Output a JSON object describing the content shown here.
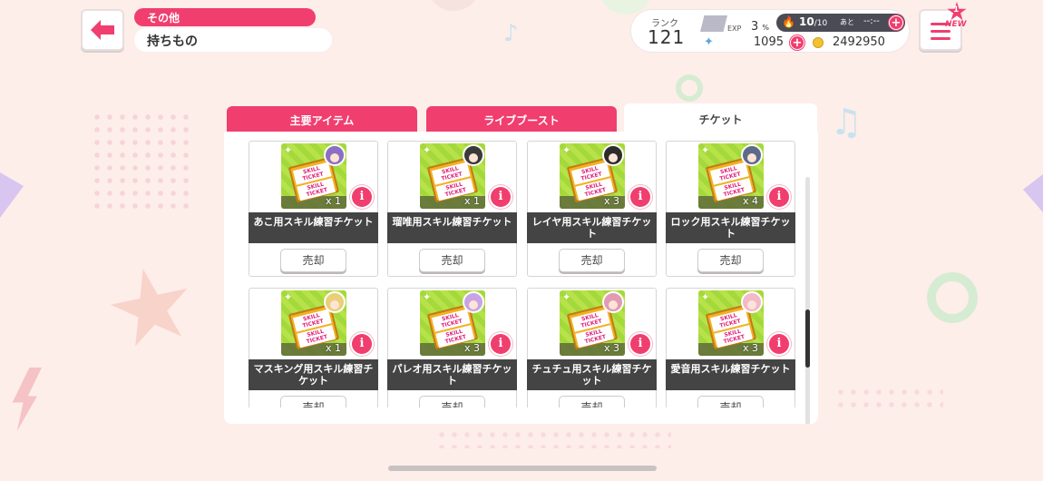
{
  "header": {
    "breadcrumb_parent": "その他",
    "breadcrumb_current": "持ちもの",
    "rank_label": "ランク",
    "rank_value": "121",
    "exp_label": "EXP",
    "exp_value": "3",
    "exp_unit": "%",
    "stamina_value": "10",
    "stamina_max": "/10",
    "stamina_next_label": "あと",
    "stamina_time": "--:--",
    "star_count": "1095",
    "coin_count": "2492950",
    "new_badge_count": "1",
    "new_badge_label": "NEW"
  },
  "tabs": [
    {
      "label": "主要アイテム",
      "active": false
    },
    {
      "label": "ライブブースト",
      "active": false
    },
    {
      "label": "チケット",
      "active": true
    }
  ],
  "ticket_text": {
    "line1": "SKILL TICKET",
    "line2": "SKILL TICKET"
  },
  "items": [
    {
      "name": "あこ用スキル練習チケット",
      "qty": "x 1",
      "sell_label": "売却",
      "chara_color": "#8b6fc2"
    },
    {
      "name": "瑠唯用スキル練習チケット",
      "qty": "x 1",
      "sell_label": "売却",
      "chara_color": "#3a3a3a"
    },
    {
      "name": "レイヤ用スキル練習チケット",
      "qty": "x 3",
      "sell_label": "売却",
      "chara_color": "#2e2b2b"
    },
    {
      "name": "ロック用スキル練習チケット",
      "qty": "x 4",
      "sell_label": "売却",
      "chara_color": "#5d6a8a"
    },
    {
      "name": "マスキング用スキル練習チケット",
      "qty": "x 1",
      "sell_label": "売却",
      "chara_color": "#e9cf7a"
    },
    {
      "name": "パレオ用スキル練習チケット",
      "qty": "x 3",
      "sell_label": "売却",
      "chara_color": "#c8a4e4"
    },
    {
      "name": "チュチュ用スキル練習チケット",
      "qty": "x 3",
      "sell_label": "売却",
      "chara_color": "#e29bb4"
    },
    {
      "name": "愛音用スキル練習チケット",
      "qty": "x 3",
      "sell_label": "売却",
      "chara_color": "#f2b9c8"
    }
  ],
  "colors": {
    "accent": "#f03e6f",
    "background": "#fdeeea",
    "ticket_bg": "#a4d93b"
  }
}
